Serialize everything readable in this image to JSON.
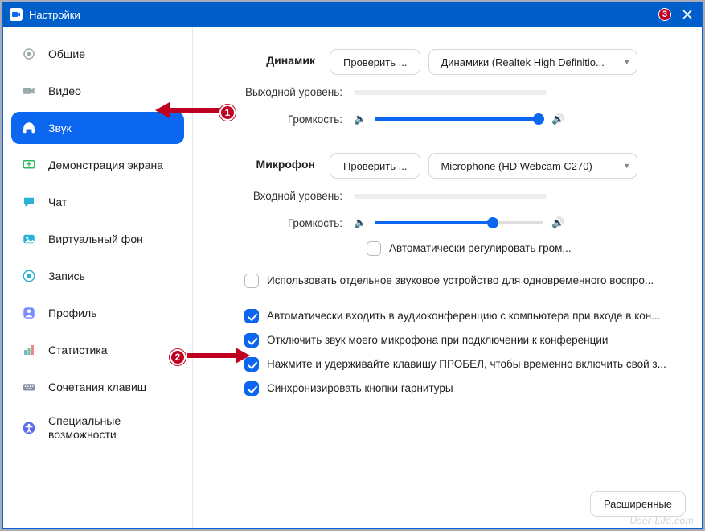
{
  "window": {
    "title": "Настройки",
    "badge3": "3"
  },
  "sidebar": {
    "items": [
      {
        "label": "Общие"
      },
      {
        "label": "Видео"
      },
      {
        "label": "Звук"
      },
      {
        "label": "Демонстрация экрана"
      },
      {
        "label": "Чат"
      },
      {
        "label": "Виртуальный фон"
      },
      {
        "label": "Запись"
      },
      {
        "label": "Профиль"
      },
      {
        "label": "Статистика"
      },
      {
        "label": "Сочетания клавиш"
      },
      {
        "label": "Специальные возможности"
      }
    ]
  },
  "callouts": {
    "n1": "1",
    "n2": "2"
  },
  "speaker": {
    "section": "Динамик",
    "test": "Проверить ...",
    "device": "Динамики (Realtek High Definitio...",
    "out_label": "Выходной уровень:",
    "vol_label": "Громкость:",
    "vol_pct": 97
  },
  "mic": {
    "section": "Микрофон",
    "test": "Проверить ...",
    "device": "Microphone (HD Webcam C270)",
    "in_label": "Входной уровень:",
    "vol_label": "Громкость:",
    "vol_pct": 70,
    "auto_gain": {
      "checked": false,
      "label": "Автоматически регулировать гром..."
    }
  },
  "opts": {
    "sep_device": {
      "checked": false,
      "label": "Использовать отдельное звуковое устройство для одновременного воспро..."
    },
    "auto_join": {
      "checked": true,
      "label": "Автоматически входить в аудиоконференцию с компьютера при входе в кон..."
    },
    "mute_on_join": {
      "checked": true,
      "label": "Отключить звук моего микрофона при подключении к конференции"
    },
    "push_to_talk": {
      "checked": true,
      "label": "Нажмите и удерживайте клавишу ПРОБЕЛ, чтобы временно включить свой з..."
    },
    "sync_headset": {
      "checked": true,
      "label": "Синхронизировать кнопки гарнитуры"
    }
  },
  "footer": {
    "advanced": "Расширенные"
  },
  "watermark": "User-Life.com"
}
